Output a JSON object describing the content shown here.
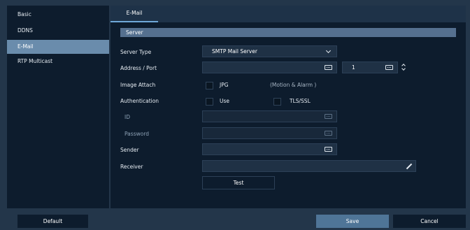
{
  "sidebar": {
    "items": [
      {
        "label": "Basic"
      },
      {
        "label": "DDNS"
      },
      {
        "label": "E-Mail",
        "active": true
      },
      {
        "label": "RTP Multicast"
      }
    ]
  },
  "tabs": [
    {
      "label": "E-Mail"
    }
  ],
  "section": {
    "title": "Server"
  },
  "form": {
    "server_type": {
      "label": "Server Type",
      "value": "SMTP Mail Server"
    },
    "address_port": {
      "label": "Address / Port",
      "address": "",
      "port": "1"
    },
    "image_attach": {
      "label": "Image Attach",
      "option": "JPG",
      "note": "(Motion & Alarm )",
      "checked": false
    },
    "authentication": {
      "label": "Authentication",
      "use_label": "Use",
      "tls_label": "TLS/SSL",
      "use_checked": false,
      "tls_checked": false
    },
    "id": {
      "label": "ID",
      "value": ""
    },
    "password": {
      "label": "Password",
      "value": ""
    },
    "sender": {
      "label": "Sender",
      "value": ""
    },
    "receiver": {
      "label": "Receiver",
      "value": ""
    },
    "test_label": "Test"
  },
  "footer": {
    "default_label": "Default",
    "save_label": "Save",
    "cancel_label": "Cancel"
  },
  "icons": {
    "keyboard": "keyboard-icon",
    "dropdown": "chevron-down-icon",
    "spinner": "spinner-icon",
    "edit": "pencil-icon"
  },
  "colors": {
    "background": "#23364a",
    "panel": "#0d1c2d",
    "active_item": "#6a8cac",
    "section_bar": "#55708f",
    "save_button": "#4f7597",
    "tab_underline": "#6fa8d8"
  }
}
